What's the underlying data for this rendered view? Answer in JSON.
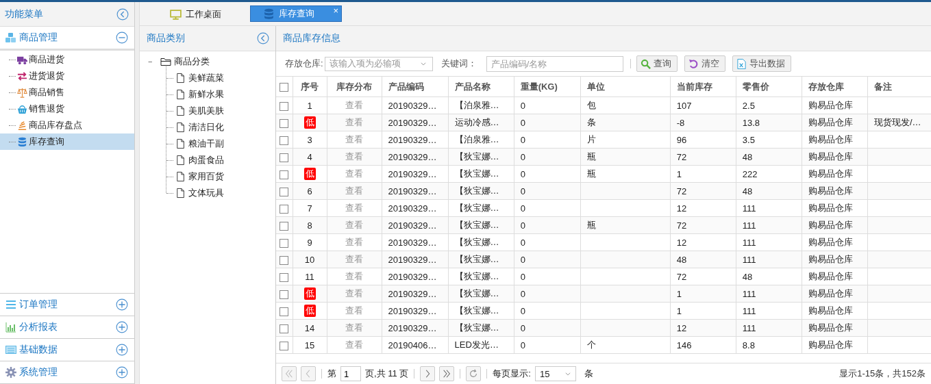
{
  "sidebar": {
    "title": "功能菜单",
    "sections": [
      {
        "label": "商品管理",
        "kind": "boxes",
        "expanded": true,
        "items": [
          {
            "label": "商品进货",
            "kind": "truck",
            "selected": false
          },
          {
            "label": "进货退货",
            "kind": "swap",
            "selected": false
          },
          {
            "label": "商品销售",
            "kind": "scale",
            "selected": false
          },
          {
            "label": "销售退货",
            "kind": "basket",
            "selected": false
          },
          {
            "label": "商品库存盘点",
            "kind": "stack",
            "selected": false
          },
          {
            "label": "库存查询",
            "kind": "db",
            "selected": true
          }
        ]
      },
      {
        "label": "订单管理",
        "kind": "lines",
        "expanded": false
      },
      {
        "label": "分析报表",
        "kind": "bars",
        "expanded": false
      },
      {
        "label": "基础数据",
        "kind": "card",
        "expanded": false
      },
      {
        "label": "系统管理",
        "kind": "gear",
        "expanded": false
      }
    ]
  },
  "tabs": [
    {
      "label": "工作桌面",
      "kind": "monitor",
      "selected": false
    },
    {
      "label": "库存查询",
      "kind": "db",
      "selected": true,
      "close": "×"
    }
  ],
  "category_panel": {
    "title": "商品类别",
    "tree": [
      {
        "label": "商品分类",
        "toggle": "−",
        "children": [
          {
            "label": "美鲜蔬菜"
          },
          {
            "label": "新鲜水果"
          },
          {
            "label": "美肌美肤"
          },
          {
            "label": "清洁日化"
          },
          {
            "label": "粮油干副"
          },
          {
            "label": "肉蛋食品"
          },
          {
            "label": "家用百货"
          },
          {
            "label": "文体玩具"
          }
        ]
      }
    ]
  },
  "grid_panel": {
    "title": "商品库存信息",
    "filters": {
      "warehouse_label": "存放仓库:",
      "warehouse_placeholder": "该输入项为必输项",
      "keyword_label": "关键词：",
      "keyword_placeholder": "产品编码/名称"
    },
    "buttons": [
      {
        "label": "查询",
        "kind": "search"
      },
      {
        "label": "清空",
        "kind": "undo"
      },
      {
        "label": "导出数据",
        "kind": "excel"
      }
    ],
    "table": {
      "select_all": false,
      "columns": [
        "序号",
        "库存分布",
        "产品编码",
        "产品名称",
        "重量(KG)",
        "单位",
        "当前库存",
        "零售价",
        "存放仓库",
        "备注"
      ],
      "rows": [
        {
          "checked": false,
          "flagged": false,
          "seq": "1",
          "view": "查看",
          "code": "20190329…",
          "name": "【泊泉雅…",
          "weight": "0",
          "unit": "包",
          "stock": "107",
          "price": "2.5",
          "warehouse": "购易品仓库",
          "note": ""
        },
        {
          "checked": false,
          "flagged": true,
          "seq": "低",
          "view": "查看",
          "code": "20190329…",
          "name": "运动冷感…",
          "weight": "0",
          "unit": "条",
          "stock": "-8",
          "price": "13.8",
          "warehouse": "购易品仓库",
          "note": "现货现发/…"
        },
        {
          "checked": false,
          "flagged": false,
          "seq": "3",
          "view": "查看",
          "code": "20190329…",
          "name": "【泊泉雅…",
          "weight": "0",
          "unit": "片",
          "stock": "96",
          "price": "3.5",
          "warehouse": "购易品仓库",
          "note": ""
        },
        {
          "checked": false,
          "flagged": false,
          "seq": "4",
          "view": "查看",
          "code": "20190329…",
          "name": "【狄宝娜…",
          "weight": "0",
          "unit": "瓶",
          "stock": "72",
          "price": "48",
          "warehouse": "购易品仓库",
          "note": ""
        },
        {
          "checked": false,
          "flagged": true,
          "seq": "低",
          "view": "查看",
          "code": "20190329…",
          "name": "【狄宝娜…",
          "weight": "0",
          "unit": "瓶",
          "stock": "1",
          "price": "222",
          "warehouse": "购易品仓库",
          "note": ""
        },
        {
          "checked": false,
          "flagged": false,
          "seq": "6",
          "view": "查看",
          "code": "20190329…",
          "name": "【狄宝娜…",
          "weight": "0",
          "unit": "",
          "stock": "72",
          "price": "48",
          "warehouse": "购易品仓库",
          "note": ""
        },
        {
          "checked": false,
          "flagged": false,
          "seq": "7",
          "view": "查看",
          "code": "20190329…",
          "name": "【狄宝娜…",
          "weight": "0",
          "unit": "",
          "stock": "12",
          "price": "111",
          "warehouse": "购易品仓库",
          "note": ""
        },
        {
          "checked": false,
          "flagged": false,
          "seq": "8",
          "view": "查看",
          "code": "20190329…",
          "name": "【狄宝娜…",
          "weight": "0",
          "unit": "瓶",
          "stock": "72",
          "price": "111",
          "warehouse": "购易品仓库",
          "note": ""
        },
        {
          "checked": false,
          "flagged": false,
          "seq": "9",
          "view": "查看",
          "code": "20190329…",
          "name": "【狄宝娜…",
          "weight": "0",
          "unit": "",
          "stock": "12",
          "price": "111",
          "warehouse": "购易品仓库",
          "note": ""
        },
        {
          "checked": false,
          "flagged": false,
          "seq": "10",
          "view": "查看",
          "code": "20190329…",
          "name": "【狄宝娜…",
          "weight": "0",
          "unit": "",
          "stock": "48",
          "price": "111",
          "warehouse": "购易品仓库",
          "note": ""
        },
        {
          "checked": false,
          "flagged": false,
          "seq": "11",
          "view": "查看",
          "code": "20190329…",
          "name": "【狄宝娜…",
          "weight": "0",
          "unit": "",
          "stock": "72",
          "price": "48",
          "warehouse": "购易品仓库",
          "note": ""
        },
        {
          "checked": false,
          "flagged": true,
          "seq": "低",
          "view": "查看",
          "code": "20190329…",
          "name": "【狄宝娜…",
          "weight": "0",
          "unit": "",
          "stock": "1",
          "price": "111",
          "warehouse": "购易品仓库",
          "note": ""
        },
        {
          "checked": false,
          "flagged": true,
          "seq": "低",
          "view": "查看",
          "code": "20190329…",
          "name": "【狄宝娜…",
          "weight": "0",
          "unit": "",
          "stock": "1",
          "price": "111",
          "warehouse": "购易品仓库",
          "note": ""
        },
        {
          "checked": false,
          "flagged": false,
          "seq": "14",
          "view": "查看",
          "code": "20190329…",
          "name": "【狄宝娜…",
          "weight": "0",
          "unit": "",
          "stock": "12",
          "price": "111",
          "warehouse": "购易品仓库",
          "note": ""
        },
        {
          "checked": false,
          "flagged": false,
          "seq": "15",
          "view": "查看",
          "code": "20190406…",
          "name": "LED发光…",
          "weight": "0",
          "unit": "个",
          "stock": "146",
          "price": "8.8",
          "warehouse": "购易品仓库",
          "note": ""
        }
      ]
    },
    "pager": {
      "page_prefix": "第",
      "page": "1",
      "page_suffix": "页,共 11 页",
      "per_page_label": "每页显示:",
      "per_page": "15",
      "per_page_unit": "条",
      "summary": "显示1-15条，共152条"
    }
  }
}
